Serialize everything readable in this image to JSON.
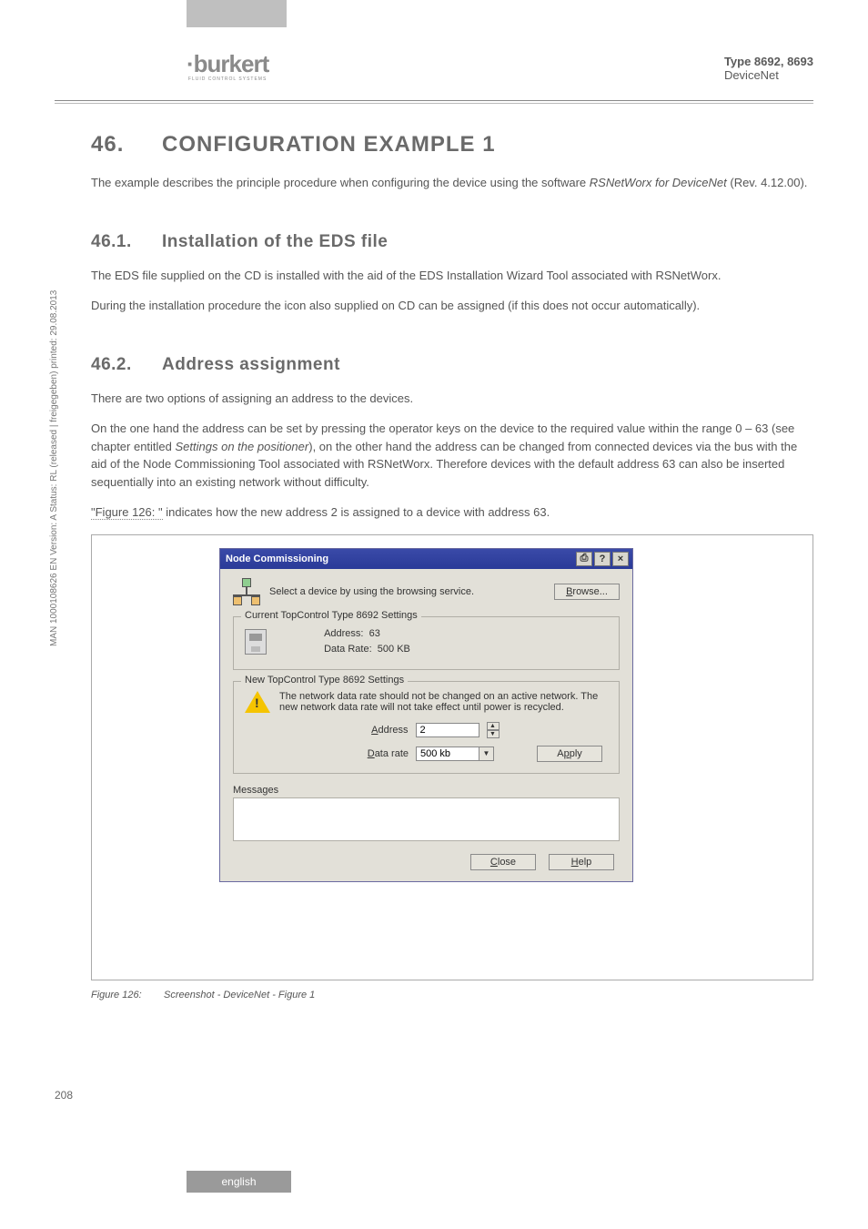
{
  "header": {
    "logo_text": "burkert",
    "logo_sub": "FLUID CONTROL SYSTEMS",
    "type_label": "Type 8692, 8693",
    "subtitle": "DeviceNet"
  },
  "section": {
    "num": "46.",
    "title": "CONFIGURATION EXAMPLE 1",
    "intro_a": "The example describes the principle procedure when configuring the device using the software ",
    "intro_ital": "RSNetWorx for DeviceNet",
    "intro_b": " (Rev. 4.12.00)."
  },
  "sub1": {
    "num": "46.1.",
    "title": "Installation of the EDS file",
    "p1": "The EDS file supplied on the CD is installed with the aid of the EDS Installation Wizard Tool associated with RSNetWorx.",
    "p2": "During the installation procedure the icon also supplied on CD can be assigned (if this does not occur automatically)."
  },
  "sub2": {
    "num": "46.2.",
    "title": "Address assignment",
    "p1": "There are two options of assigning an address to the devices.",
    "p2a": "On the one hand the address can be set by pressing the operator keys on the device to the required value within the range 0 – 63 (see chapter entitled ",
    "p2ital": "Settings on the positioner",
    "p2b": "), on the other hand the address can be changed from connected devices via the bus with the aid of the Node Commissioning Tool associated with RSNetWorx. Therefore devices with the default address 63 can also be inserted sequentially into an existing network without difficulty.",
    "p3a": "\"Figure 126: \"",
    "p3b": " indicates how the new address 2 is assigned to a device with address 63."
  },
  "dialog": {
    "title": "Node Commissioning",
    "pin_btn": "⎙",
    "help_btn": "?",
    "close_btn": "×",
    "browse_hint": "Select a device by using the browsing service.",
    "browse_btn": "Browse...",
    "group1_legend": "Current TopControl Type 8692 Settings",
    "address_lbl": "Address:",
    "address_val": "63",
    "datarate_lbl": "Data Rate:",
    "datarate_val": "500 KB",
    "group2_legend": "New TopControl Type 8692 Settings",
    "warn_text": "The network data rate should not be changed on an active network. The new network data rate will not take effect until power is recycled.",
    "new_addr_lbl": "Address",
    "new_addr_val": "2",
    "new_rate_lbl": "Data rate",
    "new_rate_val": "500 kb",
    "apply_btn": "Apply",
    "messages_lbl": "Messages",
    "close_foot": "Close",
    "help_foot": "Help"
  },
  "figure": {
    "num": "Figure 126:",
    "caption": "Screenshot - DeviceNet - Figure 1"
  },
  "page_number": "208",
  "side_text": "MAN 1000108626 EN Version: A Status: RL (released | freigegeben) printed: 29.08.2013",
  "footer_lang": "english"
}
